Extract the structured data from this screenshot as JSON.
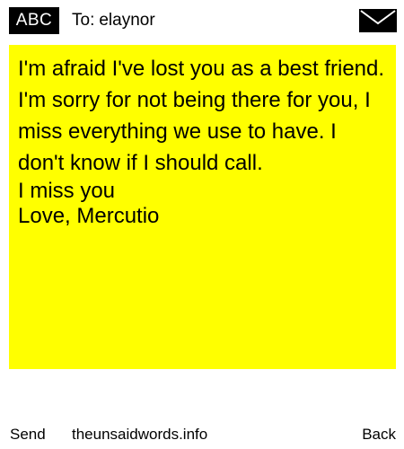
{
  "header": {
    "badge_label": "ABC",
    "to_prefix": "To:",
    "recipient": "elaynor",
    "mail_icon": "envelope-icon"
  },
  "message": {
    "body": "I'm afraid I've lost you as a best friend. I'm sorry for not being there for you, I miss everything we use to have. I don't know if I should call.",
    "line_1": "I miss you",
    "line_2": "Love, Mercutio",
    "background_color": "#ffff00"
  },
  "footer": {
    "send_label": "Send",
    "site_label": "theunsaidwords.info",
    "back_label": "Back"
  }
}
